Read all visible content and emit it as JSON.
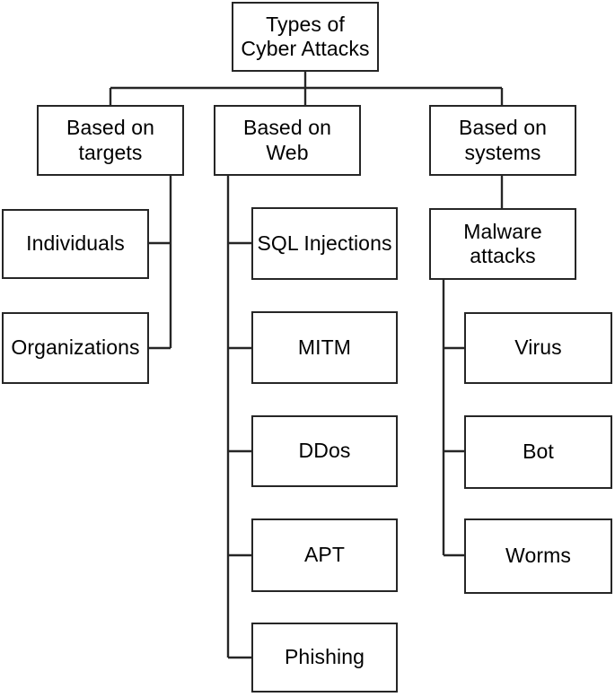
{
  "diagram": {
    "title_node": {
      "label": "Types of\nCyber Attacks"
    },
    "branches": [
      {
        "id": "targets",
        "label": "Based on\ntargets"
      },
      {
        "id": "web",
        "label": "Based on\nWeb"
      },
      {
        "id": "systems",
        "label": "Based on\nsystems"
      }
    ],
    "targets_children": [
      {
        "label": "Individuals"
      },
      {
        "label": "Organizations"
      }
    ],
    "web_children": [
      {
        "label": "SQL Injections"
      },
      {
        "label": "MITM"
      },
      {
        "label": "DDos"
      },
      {
        "label": "APT"
      },
      {
        "label": "Phishing"
      }
    ],
    "systems_children": [
      {
        "label": "Malware\nattacks"
      }
    ],
    "malware_children": [
      {
        "label": "Virus"
      },
      {
        "label": "Bot"
      },
      {
        "label": "Worms"
      }
    ],
    "colors": {
      "box_border": "#262626",
      "box_fill": "#ffffff",
      "text": "#000000",
      "connector": "#262626"
    }
  }
}
